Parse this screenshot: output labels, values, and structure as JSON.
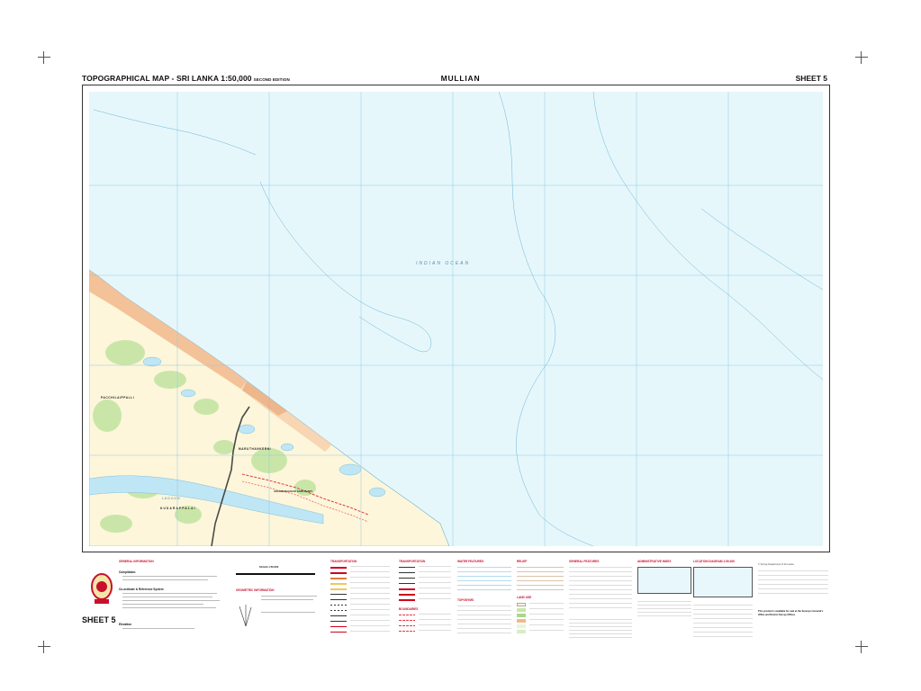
{
  "header": {
    "map_series": "TOPOGRAPHICAL MAP - SRI LANKA 1:50,000",
    "edition": "SECOND EDITION",
    "map_name": "MULLIAN",
    "sheet": "SHEET 5"
  },
  "map": {
    "ocean_label": "INDIAN OCEAN",
    "lagoon_label": "LAGOON",
    "place_labels": [
      "PACCHILAIPPALLI",
      "MARUTHANKERNI",
      "KUDARAPPALAI"
    ],
    "sanctuary_label": "VADAMARACHCHI SANCTUARY",
    "colors": {
      "sea": "#e6f7fb",
      "land": "#fdf6da",
      "settlement": "#f2b88c",
      "vegetation": "#c9e6a8",
      "grid": "#8fc9e6",
      "road": "#4a4a4a",
      "boundary": "#e0393e"
    }
  },
  "margin": {
    "sheet_label": "SHEET 5",
    "general_info": "GENERAL INFORMATION",
    "compilation": "Compilation",
    "coords_ref": "Co-ordinate & Reference System",
    "elevation": "Elevation",
    "scale_label": "SCALE 1:50,000",
    "geometric_info": "GEOMETRIC INFORMATION",
    "transportation_1": "TRANSPORTATION",
    "transportation_2": "TRANSPORTATION",
    "boundaries": "BOUNDARIES",
    "water_features": "WATER FEATURES",
    "toponyms": "TOPONYMS",
    "relief": "RELIEF",
    "land_use": "LAND USE",
    "general_features": "GENERAL FEATURES",
    "administrative_index": "ADMINISTRATIVE INDEX",
    "location_diagram": "LOCATION DIAGRAM 1:50,000",
    "copyright_note": "© Survey Department of Sri Lanka",
    "product_note": "This product is available for sale at the Surveyor General's Office and District Survey Offices"
  }
}
